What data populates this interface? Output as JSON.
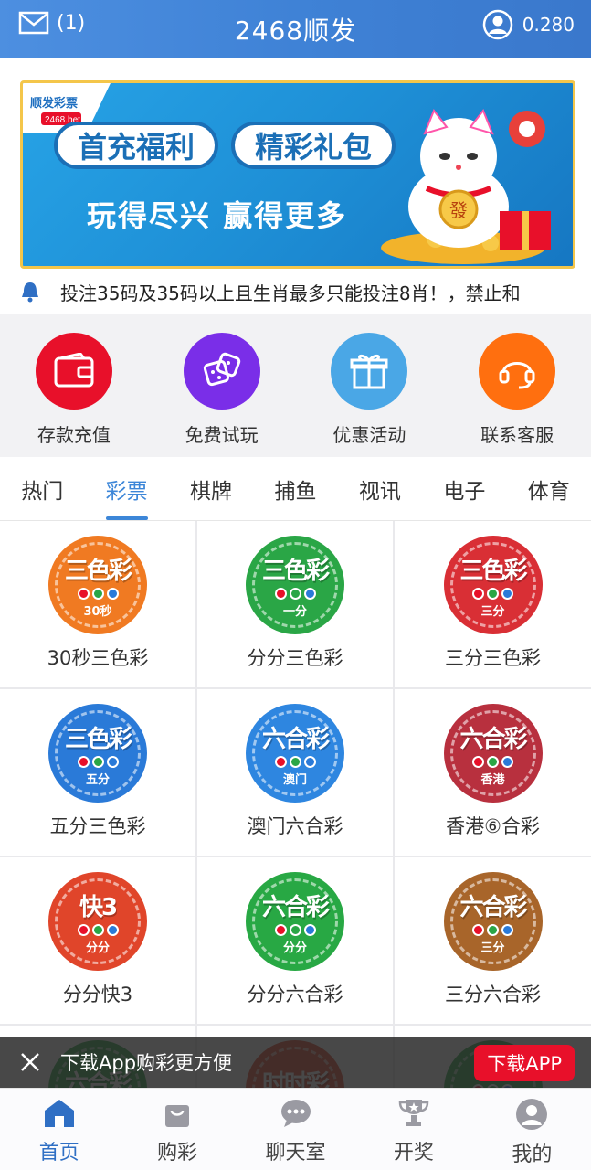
{
  "header": {
    "message_count": "(1)",
    "title": "2468顺发",
    "balance": "0.280"
  },
  "banner": {
    "brand_text": "顺发彩票",
    "badge": "2468.bet",
    "pill_1": "首充福利",
    "pill_2": "精彩礼包",
    "slogan": "玩得尽兴 赢得更多",
    "cat_text": "發"
  },
  "notice": {
    "text": "投注35码及35码以上且生肖最多只能投注8肖！，禁止和"
  },
  "actions": [
    {
      "label": "存款充值",
      "color": "#e8102a"
    },
    {
      "label": "免费试玩",
      "color": "#7a2ee8"
    },
    {
      "label": "优惠活动",
      "color": "#4aa7e6"
    },
    {
      "label": "联系客服",
      "color": "#ff6f0f"
    }
  ],
  "tabs": [
    "热门",
    "彩票",
    "棋牌",
    "捕鱼",
    "视讯",
    "电子",
    "体育"
  ],
  "active_tab": "彩票",
  "games": [
    {
      "label": "30秒三色彩",
      "chip_title": "三色彩",
      "chip_sub": "30秒",
      "color": "#f07a22"
    },
    {
      "label": "分分三色彩",
      "chip_title": "三色彩",
      "chip_sub": "一分",
      "color": "#2aa646"
    },
    {
      "label": "三分三色彩",
      "chip_title": "三色彩",
      "chip_sub": "三分",
      "color": "#d92f35"
    },
    {
      "label": "五分三色彩",
      "chip_title": "三色彩",
      "chip_sub": "五分",
      "color": "#2a7ad8"
    },
    {
      "label": "澳门六合彩",
      "chip_title": "六合彩",
      "chip_sub": "澳门",
      "color": "#2e86e0"
    },
    {
      "label": "香港⑥合彩",
      "chip_title": "六合彩",
      "chip_sub": "香港",
      "color": "#b8303e"
    },
    {
      "label": "分分快3",
      "chip_title": "快3",
      "chip_sub": "分分",
      "color": "#e0452a"
    },
    {
      "label": "分分六合彩",
      "chip_title": "六合彩",
      "chip_sub": "分分",
      "color": "#28a844"
    },
    {
      "label": "三分六合彩",
      "chip_title": "六合彩",
      "chip_sub": "三分",
      "color": "#a8652a"
    },
    {
      "label": "",
      "chip_title": "六合彩",
      "chip_sub": "",
      "color": "#2aa646"
    },
    {
      "label": "",
      "chip_title": "时时彩",
      "chip_sub": "",
      "color": "#e0452a"
    },
    {
      "label": "",
      "chip_title": "",
      "chip_sub": "",
      "color": "#2aa646"
    }
  ],
  "download": {
    "text": "下载App购彩更方便",
    "button": "下载APP"
  },
  "nav": [
    {
      "label": "首页",
      "icon": "home-icon"
    },
    {
      "label": "购彩",
      "icon": "shopping-bag-icon"
    },
    {
      "label": "聊天室",
      "icon": "chat-icon"
    },
    {
      "label": "开奖",
      "icon": "trophy-icon"
    },
    {
      "label": "我的",
      "icon": "user-icon"
    }
  ],
  "colors": {
    "header": "#3f82d6",
    "accent": "#3c86d8",
    "download_button": "#e8102a"
  }
}
